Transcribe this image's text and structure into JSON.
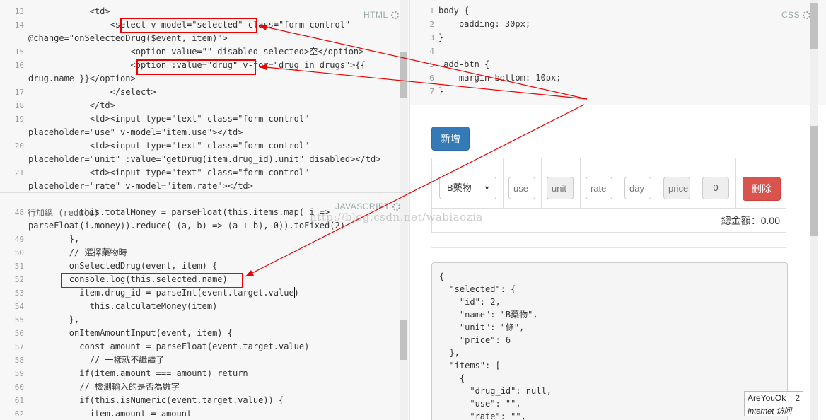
{
  "html_pane": {
    "label": "HTML",
    "lines": [
      {
        "num": "13",
        "text": "            <td>"
      },
      {
        "num": "14",
        "text": "                <select v-model=\"selected\" class=\"form-control\""
      },
      {
        "num": "",
        "text": "@change=\"onSelectedDrug($event, item)\">"
      },
      {
        "num": "15",
        "text": "                    <option value=\"\" disabled selected>空</option>"
      },
      {
        "num": "16",
        "text": "                    <option :value=\"drug\" v-for=\"drug in drugs\">{{"
      },
      {
        "num": "",
        "text": "drug.name }}</option>"
      },
      {
        "num": "17",
        "text": "                </select>"
      },
      {
        "num": "18",
        "text": "            </td>"
      },
      {
        "num": "19",
        "text": "            <td><input type=\"text\" class=\"form-control\""
      },
      {
        "num": "",
        "text": "placeholder=\"use\" v-model=\"item.use\"></td>"
      },
      {
        "num": "20",
        "text": "            <td><input type=\"text\" class=\"form-control\""
      },
      {
        "num": "",
        "text": "placeholder=\"unit\" :value=\"getDrug(item.drug_id).unit\" disabled></td>"
      },
      {
        "num": "21",
        "text": "            <td><input type=\"text\" class=\"form-control\""
      },
      {
        "num": "",
        "text": "placeholder=\"rate\" v-model=\"item.rate\"></td>"
      }
    ]
  },
  "css_pane": {
    "label": "CSS",
    "lines": [
      {
        "num": "1",
        "text": "body {"
      },
      {
        "num": "2",
        "text": "    padding: 30px;"
      },
      {
        "num": "3",
        "text": "}"
      },
      {
        "num": "4",
        "text": ""
      },
      {
        "num": "5",
        "text": ".add-btn {"
      },
      {
        "num": "6",
        "text": "    margin-bottom: 10px;"
      },
      {
        "num": "7",
        "text": "}"
      }
    ]
  },
  "js_pane": {
    "label": "JAVASCRIPT",
    "top_text": "行加總 (reduce)",
    "lines": [
      {
        "num": "48",
        "text": "          this.totalMoney = parseFloat(this.items.map( i =>"
      },
      {
        "num": "",
        "text": "parseFloat(i.money)).reduce( (a, b) => (a + b), 0)).toFixed(2)"
      },
      {
        "num": "49",
        "text": "        },"
      },
      {
        "num": "50",
        "text": "        // 選擇藥物時"
      },
      {
        "num": "51",
        "text": "        onSelectedDrug(event, item) {"
      },
      {
        "num": "52",
        "text": "        console.log(this.selected.name)"
      },
      {
        "num": "53",
        "text": "          item.drug_id = parseInt(event.target.value)"
      },
      {
        "num": "54",
        "text": "            this.calculateMoney(item)"
      },
      {
        "num": "55",
        "text": "        },"
      },
      {
        "num": "56",
        "text": "        onItemAmountInput(event, item) {"
      },
      {
        "num": "57",
        "text": "          const amount = parseFloat(event.target.value)"
      },
      {
        "num": "58",
        "text": "            // 一樣就不繼續了"
      },
      {
        "num": "59",
        "text": "          if(item.amount === amount) return"
      },
      {
        "num": "60",
        "text": "          // 檢測輸入的是否為數字"
      },
      {
        "num": "61",
        "text": "          if(this.isNumeric(event.target.value)) {"
      },
      {
        "num": "62",
        "text": "            item.amount = amount"
      }
    ]
  },
  "preview": {
    "add_button": "新增",
    "row": {
      "select_value": "B藥物",
      "use_placeholder": "use",
      "unit_placeholder": "unit",
      "rate_placeholder": "rate",
      "day_placeholder": "day",
      "price_placeholder": "price",
      "money_value": "0",
      "delete_button": "刪除"
    },
    "total_label": "總金額：0.00",
    "json_lines": [
      "{",
      "  \"selected\": {",
      "    \"id\": 2,",
      "    \"name\": \"B藥物\",",
      "    \"unit\": \"條\",",
      "    \"price\": 6",
      "  },",
      "  \"items\": [",
      "    {",
      "      \"drug_id\": null,",
      "      \"use\": \"\",",
      "      \"rate\": \"\","
    ]
  },
  "watermark": "http://blog.csdn.net/wabiaozia",
  "badge": {
    "title": "AreYouOk",
    "count": "2",
    "subtitle": "Internet 访问"
  },
  "colors": {
    "primary": "#337ab7",
    "danger": "#d9534f",
    "annotation": "#e00000"
  }
}
